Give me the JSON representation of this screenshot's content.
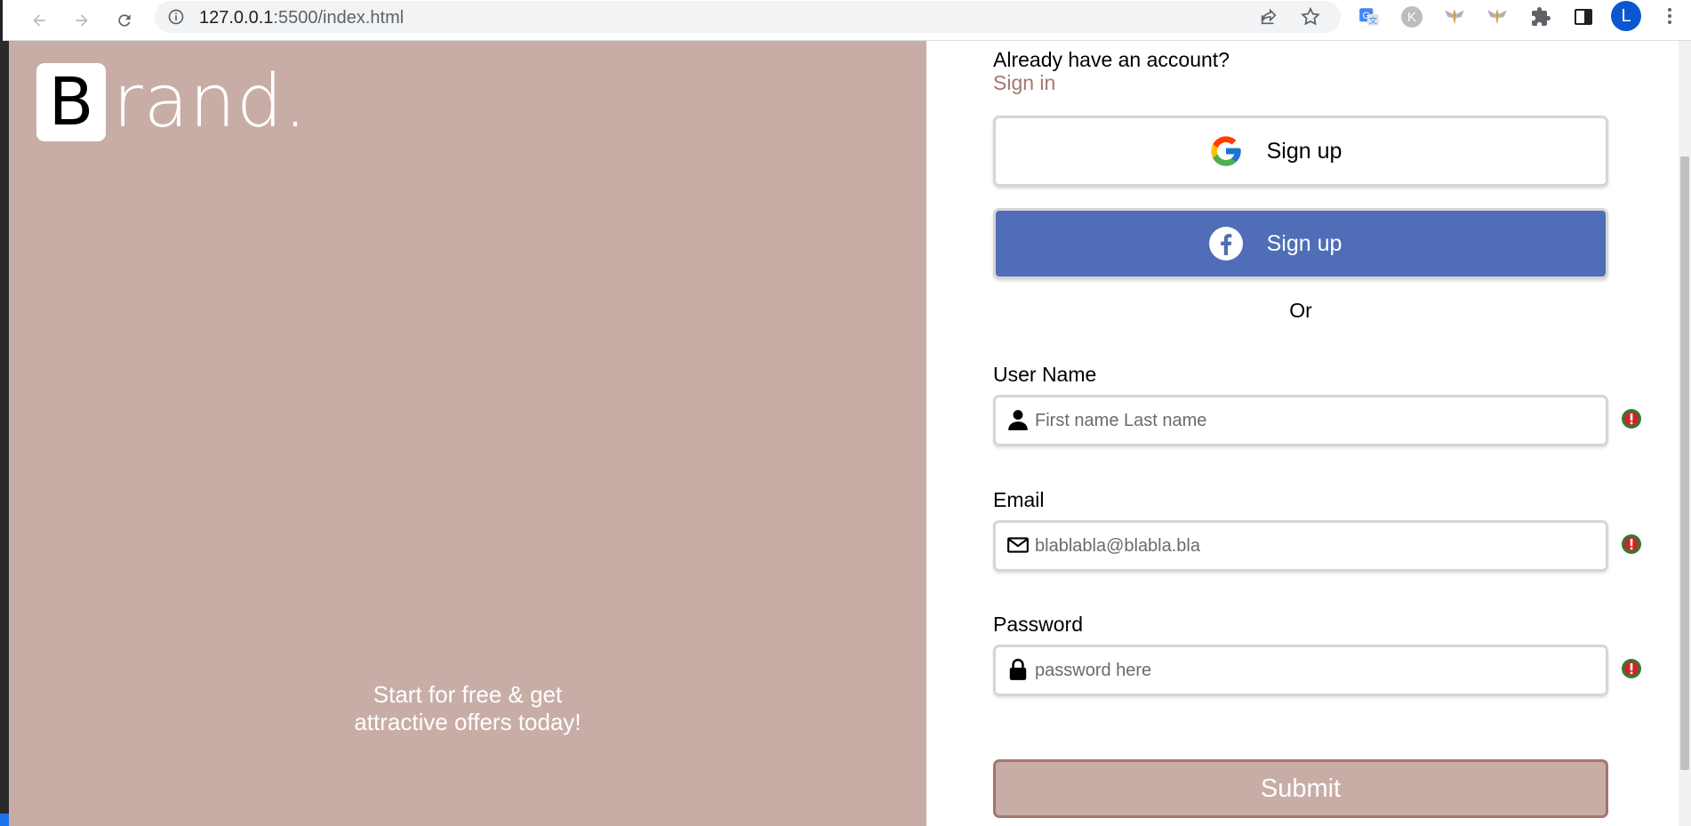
{
  "browser": {
    "url_host": "127.0.0.1",
    "url_rest": ":5500/index.html",
    "avatar_letter": "L",
    "ext_k_letter": "K"
  },
  "brand": {
    "initial": "B",
    "rest": "rand."
  },
  "hero": {
    "tagline_line1": "Start for free & get",
    "tagline_line2": "attractive offers today!",
    "background_color": "#c8ada7"
  },
  "form": {
    "already_text": "Already have an account?",
    "signin_link": "Sign in",
    "google_button": "Sign up",
    "facebook_button": "Sign up",
    "or_text": "Or",
    "fields": [
      {
        "label": "User Name",
        "placeholder": "First name Last name",
        "value": ""
      },
      {
        "label": "Email",
        "placeholder": "blablabla@blabla.bla",
        "value": ""
      },
      {
        "label": "Password",
        "placeholder": "password here",
        "value": ""
      }
    ],
    "submit_label": "Submit",
    "accent_color": "#a57670",
    "facebook_color": "#4f6eb7"
  },
  "icons": {
    "user": "user-icon",
    "email": "envelope-icon",
    "password": "lock-icon",
    "warning": "warning-icon"
  }
}
